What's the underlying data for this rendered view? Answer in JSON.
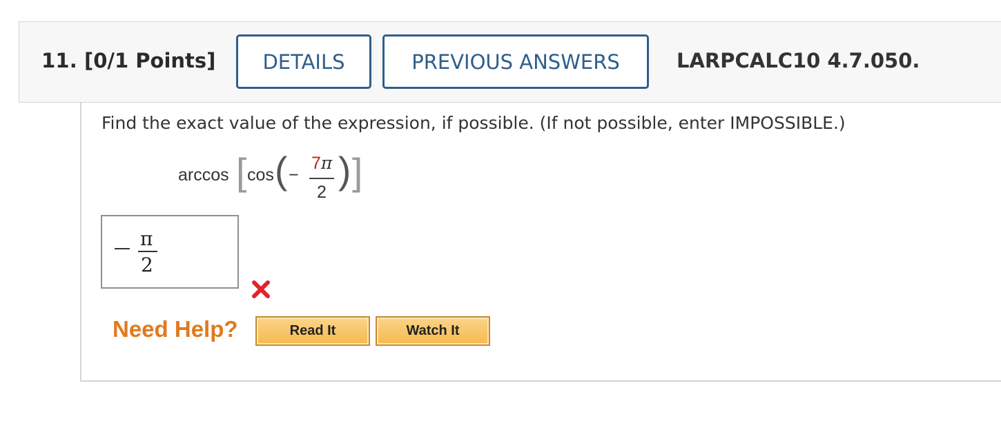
{
  "header": {
    "question_number": "11.",
    "points": "[0/1 Points]",
    "details_label": "DETAILS",
    "previous_answers_label": "PREVIOUS ANSWERS",
    "source": "LARPCALC10 4.7.050."
  },
  "question": {
    "prompt": "Find the exact value of the expression, if possible. (If not possible, enter IMPOSSIBLE.)",
    "expression": {
      "outer_function": "arccos",
      "inner_function": "cos",
      "sign": "−",
      "numerator_coefficient": "7",
      "numerator_symbol": "π",
      "denominator": "2"
    }
  },
  "answer": {
    "sign": "−",
    "numerator": "π",
    "denominator": "2",
    "status": "incorrect"
  },
  "help": {
    "label": "Need Help?",
    "read_it_label": "Read It",
    "watch_it_label": "Watch It"
  },
  "colors": {
    "button_border": "#2e5e8c",
    "incorrect_mark": "#e0242b",
    "help_label": "#e07a1f",
    "help_button": "#f5b94d",
    "highlight_number": "#c8201c"
  }
}
